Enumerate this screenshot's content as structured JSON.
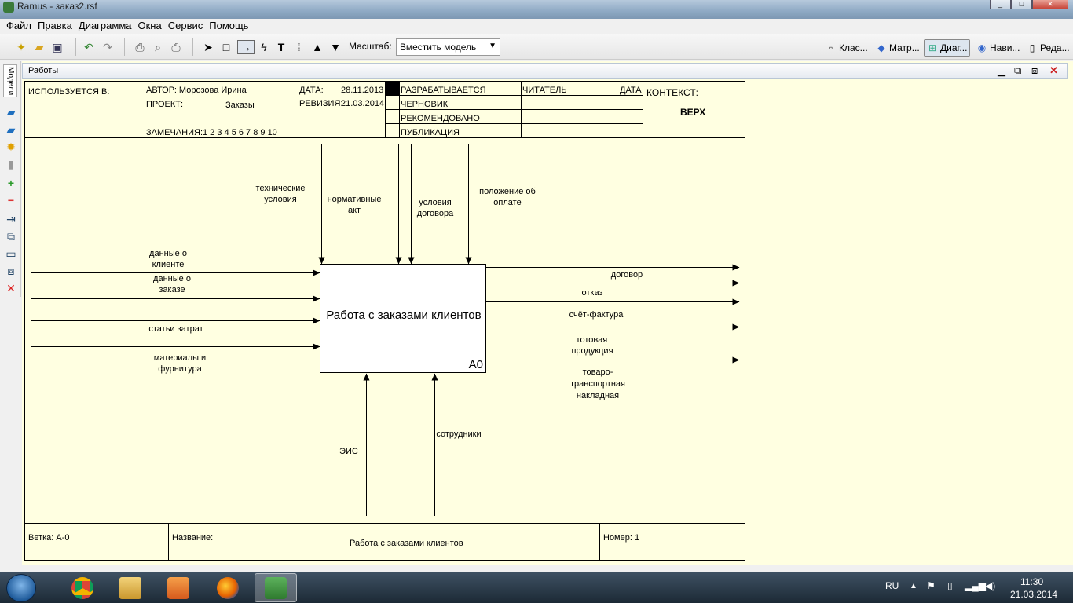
{
  "window": {
    "title": "Ramus - заказ2.rsf",
    "btn_min": "_",
    "btn_max": "□",
    "btn_close": "✕"
  },
  "menu": [
    "Файл",
    "Правка",
    "Диаграмма",
    "Окна",
    "Сервис",
    "Помощь"
  ],
  "toolbar": {
    "scale_label": "Масштаб:",
    "scale_value": "Вместить модель",
    "view_tabs": [
      "Клас...",
      "Матр...",
      "Диаг...",
      "Нави...",
      "Реда..."
    ]
  },
  "left_panel": {
    "tab_label": "Модели"
  },
  "doc_window": {
    "title": "Работы"
  },
  "idef0": {
    "header": {
      "used_in": "ИСПОЛЬЗУЕТСЯ В:",
      "author": "АВТОР: Морозова Ирина",
      "project_label": "ПРОЕКТ:",
      "project": "Заказы",
      "notes_label": "ЗАМЕЧАНИЯ:",
      "notes_numbers": "1  2  3  4  5  6  7  8  9  10",
      "date_label": "ДАТА:",
      "date": "28.11.2013",
      "revision_label": "РЕВИЗИЯ:",
      "revision": "21.03.2014",
      "status": [
        "РАЗРАБАТЫВАЕТСЯ",
        "ЧЕРНОВИК",
        "РЕКОМЕНДОВАНО",
        "ПУБЛИКАЦИЯ"
      ],
      "reader": "ЧИТАТЕЛЬ",
      "reader_date": "ДАТА",
      "context_label": "КОНТЕКСТ:",
      "context_value": "ВЕРХ"
    },
    "activity": {
      "name": "Работа с заказами клиентов",
      "number": "А0"
    },
    "controls": [
      "технические\nусловия",
      "нормативные\nакт",
      "условия\nдоговора",
      "положение об\nоплате"
    ],
    "inputs": [
      "данные о\nклиенте",
      "данные о\nзаказе",
      "статьи затрат",
      "материалы и\nфурнитура"
    ],
    "outputs": [
      "договор",
      "отказ",
      "счёт-фактура",
      "готовая\nпродукция",
      "товаро-\nтранспортная\nнакладная"
    ],
    "mechanisms": [
      "ЭИС",
      "сотрудники"
    ],
    "footer": {
      "node": "Ветка: А-0",
      "title_label": "Название:",
      "title": "Работа с заказами клиентов",
      "number": "Номер: 1"
    }
  },
  "taskbar": {
    "lang": "RU",
    "time": "11:30",
    "date": "21.03.2014"
  }
}
